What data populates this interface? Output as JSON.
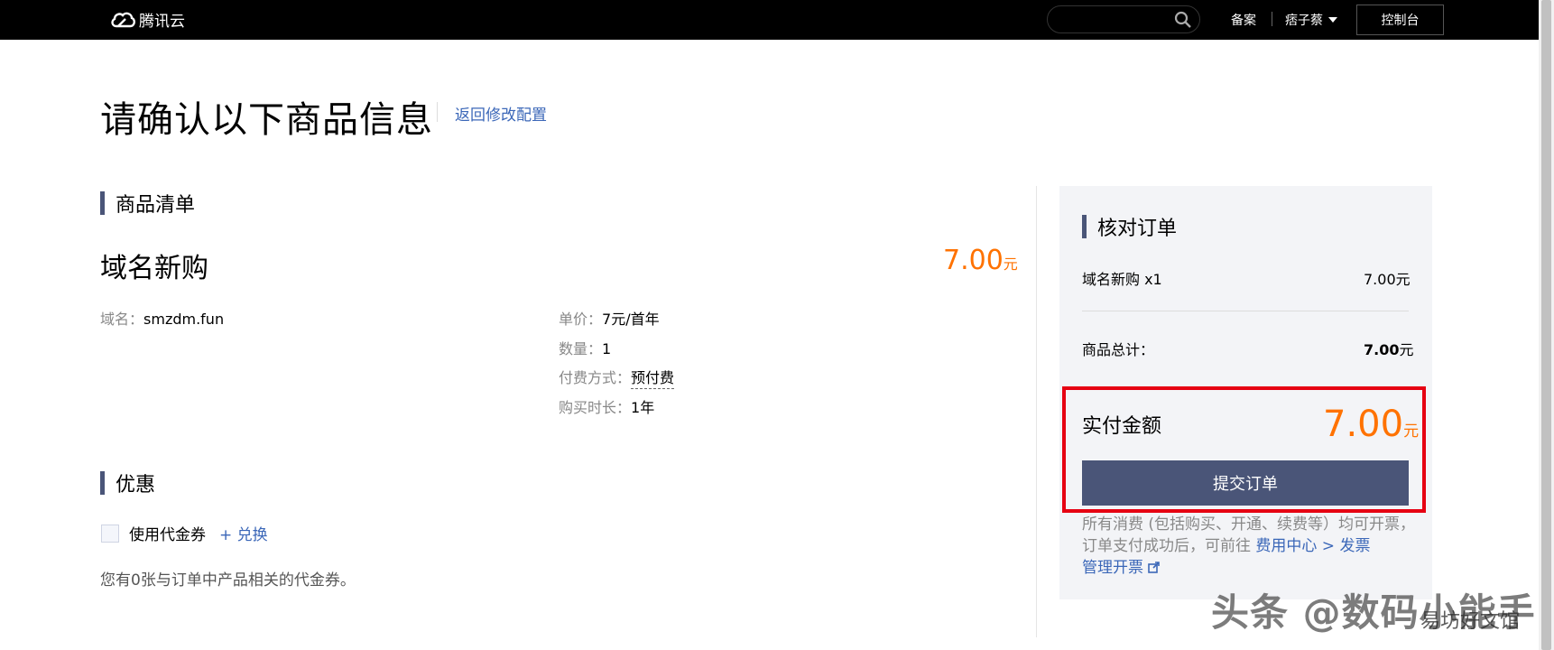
{
  "header": {
    "logo_text": "腾讯云",
    "search_placeholder": "",
    "nav_beian": "备案",
    "user_name": "痞子蔡",
    "console_label": "控制台"
  },
  "page": {
    "title": "请确认以下商品信息",
    "back_link": "返回修改配置"
  },
  "product_list": {
    "heading": "商品清单",
    "name": "域名新购",
    "price": "7.00",
    "currency": "元",
    "domain_key": "域名：",
    "domain_value": "smzdm.fun",
    "details": [
      {
        "key": "单价：",
        "value": "7元/首年"
      },
      {
        "key": "数量：",
        "value": "1"
      },
      {
        "key": "付费方式：",
        "value": "预付费"
      },
      {
        "key": "购买时长：",
        "value": "1年"
      }
    ]
  },
  "discount": {
    "heading": "优惠",
    "coupon_label": "使用代金券",
    "exchange_link": "+ 兑换",
    "note": "您有0张与订单中产品相关的代金券。",
    "checked": false
  },
  "order_summary": {
    "heading": "核对订单",
    "item_label": "域名新购 x1",
    "item_price": "7.00元",
    "total_label": "商品总计：",
    "total_value": "7.00",
    "total_unit": "元",
    "pay_label": "实付金额",
    "pay_value": "7.00",
    "pay_unit": "元",
    "submit_label": "提交订单",
    "notice_text": "所有消费 (包括购买、开通、续费等）均可开票，订单支付成功后，可前往 ",
    "notice_link1": "费用中心 > 发票",
    "notice_link2": "管理开票"
  },
  "watermark": {
    "main": "头条 @数码小能手",
    "sub": "易坊好文馆"
  },
  "colors": {
    "topbar": "#000000",
    "accent": "#4a5578",
    "price": "#ff7200",
    "link": "#3b67b8",
    "highlight_box": "#e60012"
  }
}
